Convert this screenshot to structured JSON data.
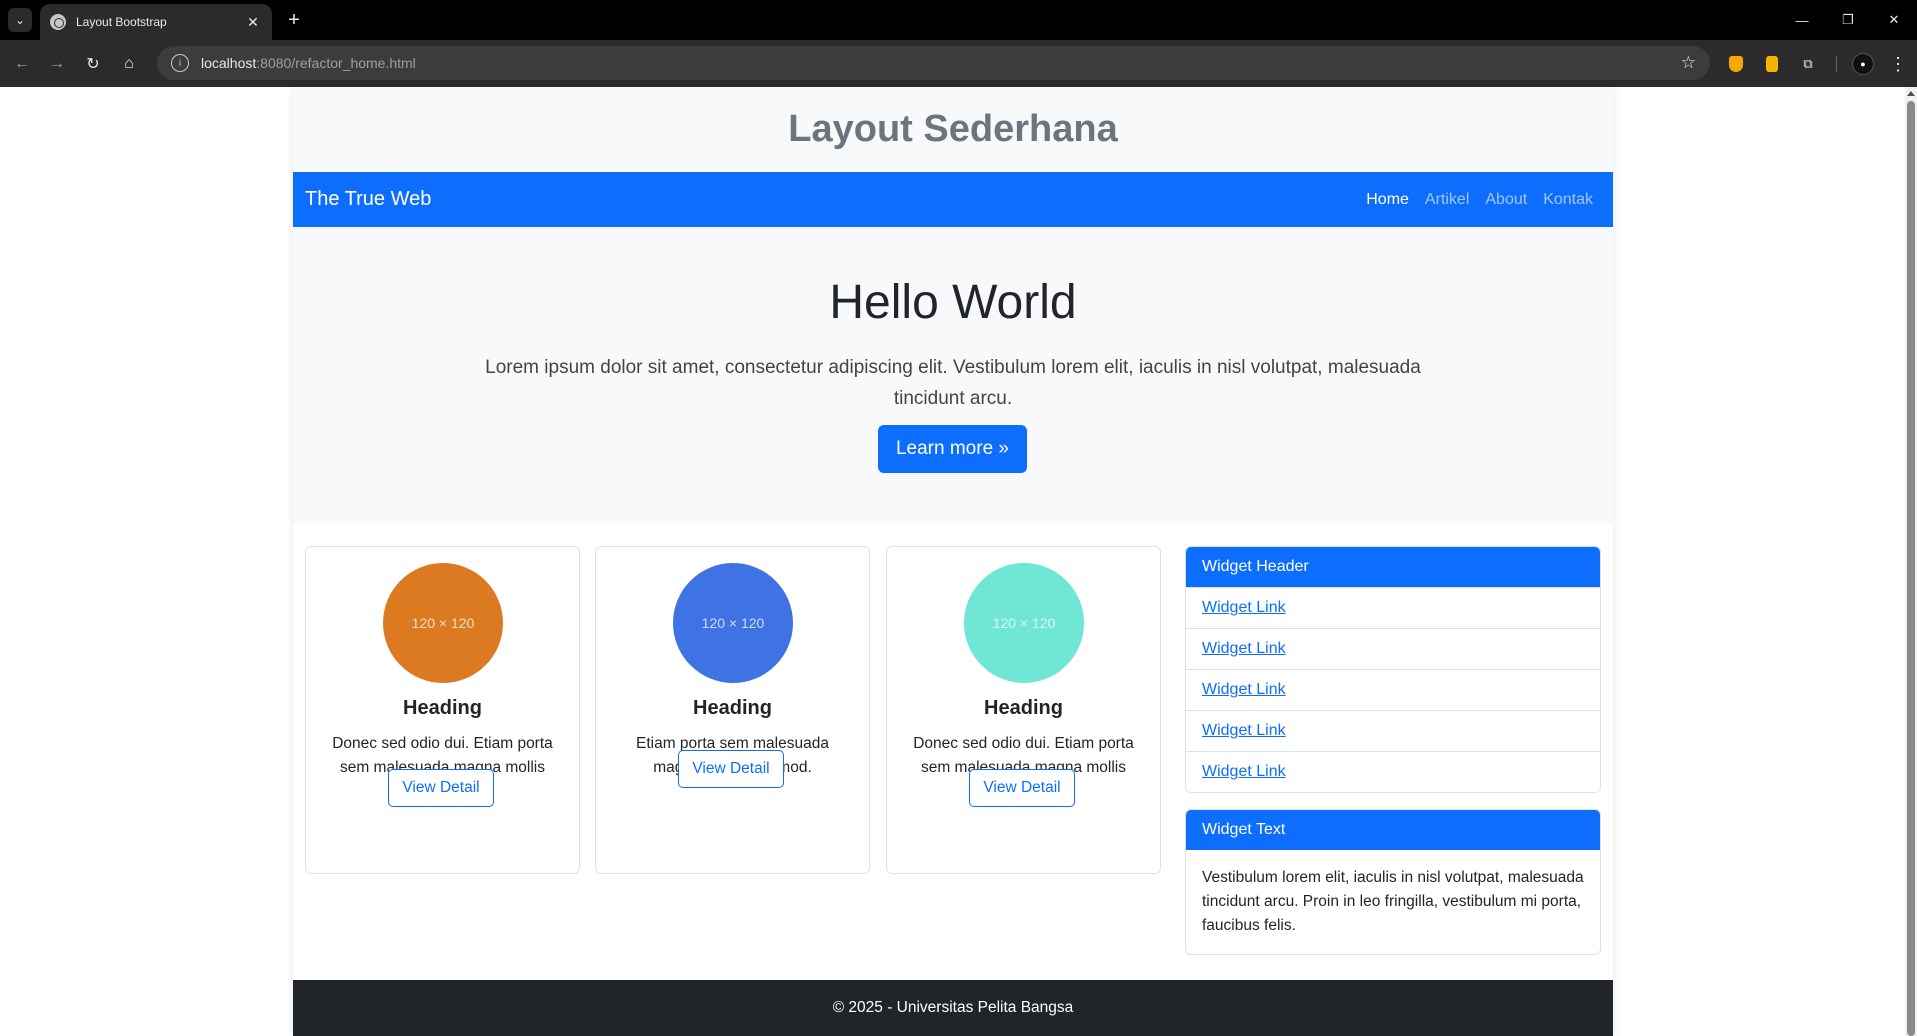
{
  "browser": {
    "tab_title": "Layout Bootstrap",
    "url_host": "localhost",
    "url_rest": ":8080/refactor_home.html",
    "new_tab": "+",
    "close_tab": "✕"
  },
  "site": {
    "title": "Layout Sederhana",
    "brand": "The True Web",
    "nav": [
      "Home",
      "Artikel",
      "About",
      "Kontak"
    ],
    "active_nav": "Home"
  },
  "hero": {
    "title": "Hello World",
    "lead": "Lorem ipsum dolor sit amet, consectetur adipiscing elit. Vestibulum lorem elit, iaculis in nisl volutpat, malesuada tincidunt arcu.",
    "button": "Learn more »"
  },
  "cards": [
    {
      "placeholder": "120 × 120",
      "color": "#dc7a22",
      "heading": "Heading",
      "text": "Donec sed odio dui. Etiam porta sem malesuada magna mollis euismod.",
      "button": "View Detail"
    },
    {
      "placeholder": "120 × 120",
      "color": "#3f72e3",
      "heading": "Heading",
      "text": "Etiam porta sem malesuada magna mollis euismod.",
      "button": "View Detail"
    },
    {
      "placeholder": "120 × 120",
      "color": "#70e6d4",
      "heading": "Heading",
      "text": "Donec sed odio dui. Etiam porta sem malesuada magna mollis euismod.",
      "button": "View Detail"
    }
  ],
  "widgets": {
    "links_header": "Widget Header",
    "links": [
      "Widget Link",
      "Widget Link",
      "Widget Link",
      "Widget Link",
      "Widget Link"
    ],
    "text_header": "Widget Text",
    "text_body": "Vestibulum lorem elit, iaculis in nisl volutpat, malesuada tincidunt arcu. Proin in leo fringilla, vestibulum mi porta, faucibus felis."
  },
  "footer": {
    "text": "© 2025 - Universitas Pelita Bangsa"
  },
  "colors": {
    "primary": "#0d6efd",
    "light": "#f8f9fa",
    "dark": "#212529"
  }
}
